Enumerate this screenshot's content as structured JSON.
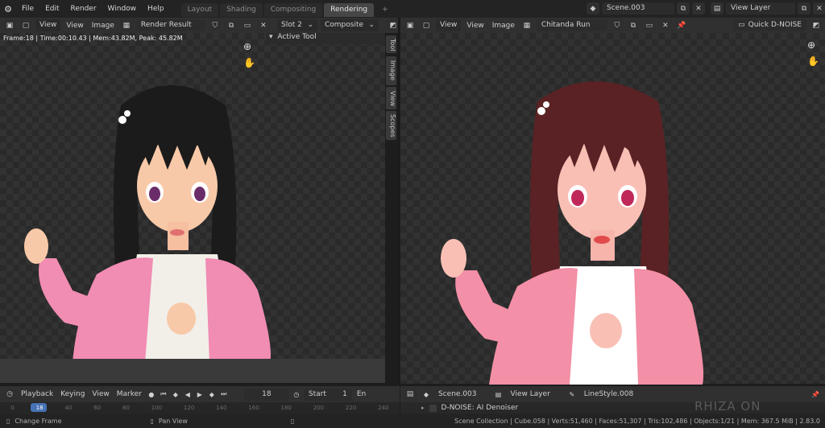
{
  "topbar": {
    "menu": [
      "File",
      "Edit",
      "Render",
      "Window",
      "Help"
    ],
    "workspaces": [
      {
        "label": "Layout",
        "active": false
      },
      {
        "label": "Shading",
        "active": false
      },
      {
        "label": "Compositing",
        "active": false
      },
      {
        "label": "Rendering",
        "active": true
      }
    ],
    "add_tab": "+",
    "scene": "Scene.003",
    "view_layer": "View Layer"
  },
  "left_editor": {
    "header": {
      "view": "View",
      "menu_view": "View",
      "menu_image": "Image",
      "image_name": "Render Result",
      "slot": "Slot 2",
      "pass": "Composite"
    },
    "info": "Frame:18 | Time:00:10.43 | Mem:43.82M, Peak: 45.82M",
    "panel_title": "Active Tool",
    "side_tabs": [
      "Tool",
      "Image",
      "View",
      "Scopes"
    ]
  },
  "right_editor": {
    "header": {
      "view": "View",
      "menu_view": "View",
      "menu_image": "Image",
      "image_name": "Chitanda Run !!!.png",
      "addon_button": "Quick D-NOISE"
    }
  },
  "timeline": {
    "menu": [
      "Playback",
      "Keying",
      "View",
      "Marker"
    ],
    "current_frame": "18",
    "start_label": "Start",
    "start_value": "1",
    "end_label": "En",
    "ruler_ticks": [
      "0",
      "18",
      "40",
      "60",
      "80",
      "100",
      "120",
      "140",
      "160",
      "180",
      "200",
      "220",
      "240"
    ]
  },
  "properties": {
    "scene": "Scene.003",
    "view_layer": "View Layer",
    "linestyle": "LineStyle.008",
    "panel": "D-NOISE: AI Denoiser"
  },
  "status": {
    "change_frame": "Change Frame",
    "pan_view": "Pan View",
    "stats": "Scene Collection | Cube.058 | Verts:51,460 | Faces:51,307 | Tris:102,486 | Objects:1/21 | Mem: 367.5 MiB | 2.83.0",
    "watermark": "RHIZA ON BLENDER"
  },
  "colors": {
    "accent": "#4772b3",
    "header": "#303030",
    "background": "#1d1d1d"
  }
}
